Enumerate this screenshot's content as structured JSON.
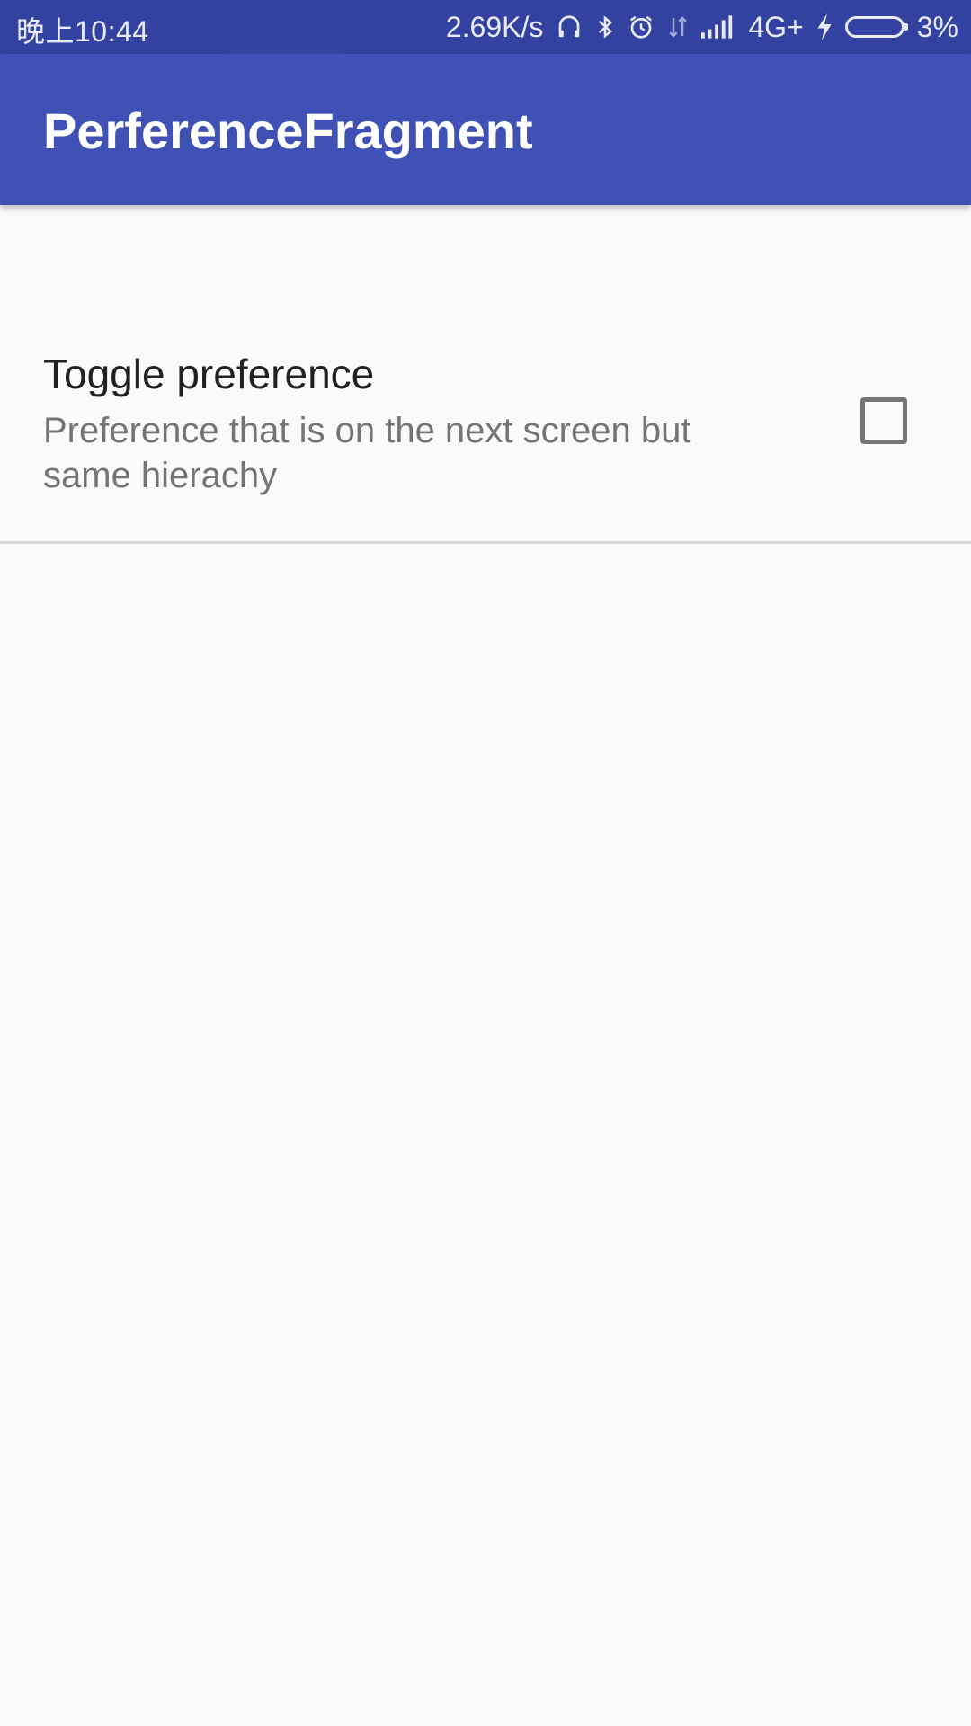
{
  "status_bar": {
    "time": "晚上10:44",
    "network_speed": "2.69K/s",
    "network_type": "4G+",
    "battery_percent": "3%",
    "icons": [
      "headset-icon",
      "bluetooth-icon",
      "alarm-icon",
      "data-arrows-icon",
      "signal-icon",
      "charging-icon",
      "battery-icon"
    ]
  },
  "app_bar": {
    "title": "PerferenceFragment",
    "color": "#3F51B5",
    "status_color": "#303F9F"
  },
  "preferences": [
    {
      "title": "Toggle preference",
      "summary": "Preference that is on the next screen but same hierachy",
      "checked": false
    }
  ]
}
